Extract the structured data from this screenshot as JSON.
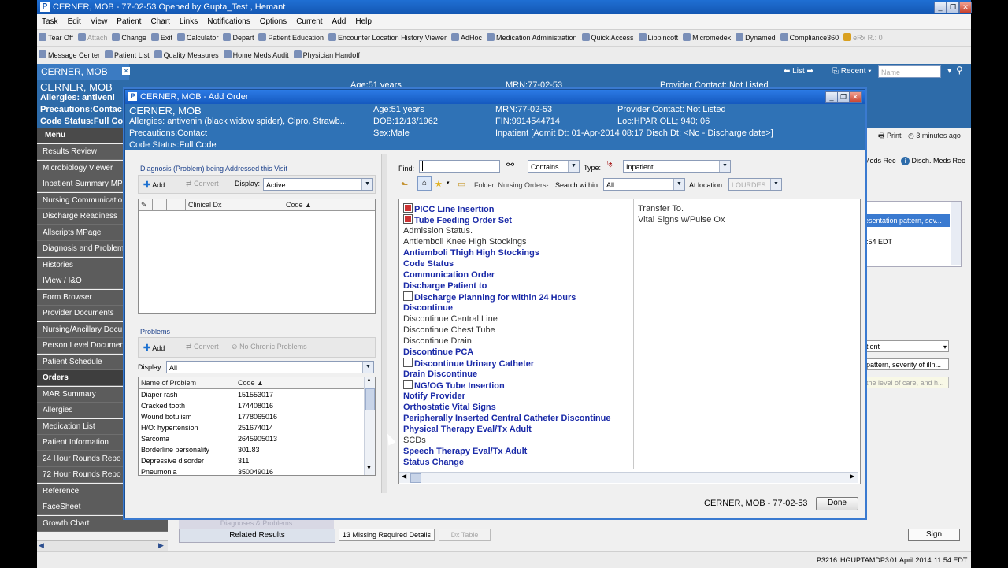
{
  "window": {
    "title": "CERNER, MOB - 77-02-53 Opened by Gupta_Test , Hemant",
    "logo": "P"
  },
  "menubar": [
    "Task",
    "Edit",
    "View",
    "Patient",
    "Chart",
    "Links",
    "Notifications",
    "Options",
    "Current",
    "Add",
    "Help"
  ],
  "toolbar1": [
    "Tear Off",
    "Attach",
    "Change",
    "Exit",
    "Calculator",
    "Depart",
    "Patient Education",
    "Encounter Location History Viewer",
    "AdHoc",
    "Medication Administration",
    "Quick Access",
    "Lippincott",
    "Micromedex",
    "Dynamed",
    "Compliance360",
    "eRx R.: 0"
  ],
  "toolbar2": [
    "Message Center",
    "Patient List",
    "Quality Measures",
    "Home Meds Audit",
    "Physician Handoff"
  ],
  "nav": {
    "list_label": "List",
    "recent_label": "Recent",
    "name_placeholder": "Name"
  },
  "patient": {
    "name": "CERNER, MOB",
    "allergies_short": "Allergies: antiveni",
    "precautions_short": "Precautions:Contac",
    "code_status_short": "Code Status:Full Co",
    "age_bg": "Age:51 years",
    "mrn_bg": "MRN:77-02-53",
    "provider_bg": "Provider Contact: Not Listed"
  },
  "leftmenu": {
    "header": "Menu",
    "items": [
      "Results Review",
      "Microbiology Viewer",
      "Inpatient Summary MPa",
      "Nursing Communicatio",
      "Discharge Readiness",
      "Allscripts MPage",
      "Diagnosis and Problem",
      "Histories",
      "IView / I&O",
      "Form Browser",
      "Provider Documents",
      "Nursing/Ancillary Docu",
      "Person Level Documen",
      "Patient Schedule",
      "Orders",
      "MAR Summary",
      "Allergies",
      "Medication List",
      "Patient Information",
      "24 Hour Rounds Repo",
      "72 Hour Rounds Repo",
      "Reference",
      "FaceSheet",
      "Growth Chart"
    ],
    "selected": "Orders"
  },
  "background_right": {
    "print_label": "Print",
    "updated_label": "3 minutes ago",
    "meds_rec_label": "Meds Rec",
    "disch_meds_rec_label": "Disch. Meds Rec",
    "presentation_text": "esentation pattern, sev...",
    "edt_text": ":54 EDT",
    "patient_select": "tient",
    "pattern_text": "pattern, severity of illn...",
    "level_text": "the level of care, and h...",
    "related_results": "Related Results",
    "diagnoses_problems": "Diagnoses & Problems",
    "missing_details": "13 Missing Required Details",
    "dx_table": "Dx Table",
    "sign": "Sign"
  },
  "dialog": {
    "title": "CERNER, MOB - Add Order",
    "banner": {
      "name": "CERNER, MOB",
      "allergies": "Allergies: antivenin (black widow spider), Cipro, Strawb...",
      "precautions": "Precautions:Contact",
      "code_status": "Code Status:Full Code",
      "age": "Age:51 years",
      "dob": "DOB:12/13/1962",
      "sex": "Sex:Male",
      "mrn": "MRN:77-02-53",
      "fin": "FIN:9914544714",
      "inpatient": "Inpatient [Admit Dt: 01-Apr-2014 08:17  Disch Dt: <No - Discharge date>]",
      "provider": "Provider Contact: Not Listed",
      "loc": "Loc:HPAR OLL; 940; 06"
    },
    "diagnosis": {
      "group_label": "Diagnosis (Problem) being Addressed this Visit",
      "add_label": "Add",
      "convert_label": "Convert",
      "display_label": "Display:",
      "display_value": "Active",
      "col_clinical_dx": "Clinical Dx",
      "col_code": "Code"
    },
    "problems": {
      "group_label": "Problems",
      "add_label": "Add",
      "convert_label": "Convert",
      "no_chronic_label": "No Chronic Problems",
      "display_label": "Display:",
      "display_value": "All",
      "col_name": "Name of Problem",
      "col_code": "Code",
      "rows": [
        {
          "name": "Diaper rash",
          "code": "151553017"
        },
        {
          "name": "Cracked tooth",
          "code": "174408016"
        },
        {
          "name": "Wound botulism",
          "code": "1778065016"
        },
        {
          "name": "H/O: hypertension",
          "code": "251674014"
        },
        {
          "name": "Sarcoma",
          "code": "2645905013"
        },
        {
          "name": "Borderline personality",
          "code": "301.83"
        },
        {
          "name": "Depressive disorder",
          "code": "311"
        },
        {
          "name": "Pneumonia",
          "code": "350049016"
        }
      ]
    },
    "search": {
      "find_label": "Find:",
      "find_value": "",
      "match_value": "Contains",
      "type_label": "Type:",
      "type_value": "Inpatient",
      "folder_label": "Folder: Nursing Orders-...",
      "search_within_label": "Search within:",
      "search_within_value": "All",
      "at_location_label": "At location:",
      "at_location_value": "LOURDES"
    },
    "orders_col1": [
      {
        "text": "PICC Line Insertion",
        "style": "b",
        "icon": "red"
      },
      {
        "text": "Tube Feeding Order Set",
        "style": "b",
        "icon": "red"
      },
      {
        "text": "Admission Status.",
        "style": "n",
        "icon": ""
      },
      {
        "text": "Antiemboli Knee High Stockings",
        "style": "n",
        "icon": ""
      },
      {
        "text": "Antiemboli Thigh High Stockings",
        "style": "b",
        "icon": ""
      },
      {
        "text": "Code Status",
        "style": "b",
        "icon": ""
      },
      {
        "text": "Communication Order",
        "style": "b",
        "icon": ""
      },
      {
        "text": "Discharge Patient to",
        "style": "b",
        "icon": ""
      },
      {
        "text": "Discharge Planning for within 24 Hours",
        "style": "b",
        "icon": "doc"
      },
      {
        "text": "Discontinue",
        "style": "b",
        "icon": ""
      },
      {
        "text": "Discontinue Central Line",
        "style": "n",
        "icon": ""
      },
      {
        "text": "Discontinue Chest Tube",
        "style": "n",
        "icon": ""
      },
      {
        "text": "Discontinue Drain",
        "style": "n",
        "icon": ""
      },
      {
        "text": "Discontinue PCA",
        "style": "b",
        "icon": ""
      },
      {
        "text": "Discontinue Urinary Catheter",
        "style": "b",
        "icon": "doc"
      },
      {
        "text": "Drain Discontinue",
        "style": "b",
        "icon": ""
      },
      {
        "text": "NG/OG Tube Insertion",
        "style": "b",
        "icon": "doc"
      },
      {
        "text": "Notify Provider",
        "style": "b",
        "icon": ""
      },
      {
        "text": "Orthostatic Vital Signs",
        "style": "b",
        "icon": ""
      },
      {
        "text": "Peripherally Inserted Central Catheter Discontinue",
        "style": "b",
        "icon": ""
      },
      {
        "text": "Physical Therapy Eval/Tx Adult",
        "style": "b",
        "icon": ""
      },
      {
        "text": "SCDs",
        "style": "n",
        "icon": ""
      },
      {
        "text": "Speech Therapy Eval/Tx Adult",
        "style": "b",
        "icon": ""
      },
      {
        "text": "Status Change",
        "style": "b",
        "icon": ""
      }
    ],
    "orders_col2": [
      "Transfer To.",
      "Vital Signs w/Pulse Ox"
    ],
    "footer_name": "CERNER, MOB - 77-02-53",
    "done_label": "Done"
  },
  "statusbar": {
    "code": "P3216",
    "user": "HGUPTAMDP3",
    "date": "01 April 2014",
    "time": "11:54 EDT"
  }
}
